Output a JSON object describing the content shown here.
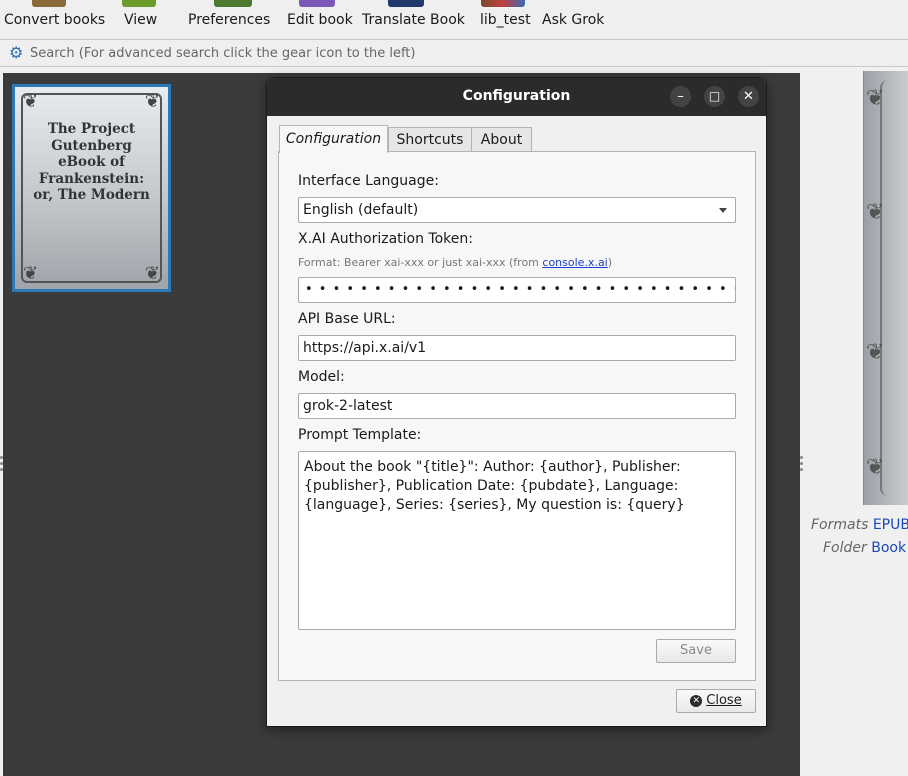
{
  "toolbar": {
    "items": [
      {
        "label": "Convert books",
        "icon": "convert-books-icon"
      },
      {
        "label": "View",
        "icon": "view-icon"
      },
      {
        "label": "Preferences",
        "icon": "preferences-icon"
      },
      {
        "label": "Edit book",
        "icon": "edit-book-icon"
      },
      {
        "label": "Translate Book",
        "icon": "translate-book-icon"
      },
      {
        "label": "lib_test",
        "icon": "lib-test-icon"
      },
      {
        "label": "Ask Grok",
        "icon": "ask-grok-icon"
      }
    ]
  },
  "search": {
    "placeholder": "Search (For advanced search click the gear icon to the left)",
    "icon": "gear-icon"
  },
  "library": {
    "book_cover_title": "The Project Gutenberg eBook of Frankenstein: or, The Modern"
  },
  "details": {
    "formats_label": "Formats",
    "formats_value": "EPUB",
    "folder_label": "Folder",
    "folder_value": "Book"
  },
  "dialog": {
    "title": "Configuration",
    "tabs": [
      "Configuration",
      "Shortcuts",
      "About"
    ],
    "active_tab": "Configuration",
    "interface_language_label": "Interface Language:",
    "interface_language_value": "English (default)",
    "token_label": "X.AI Authorization Token:",
    "token_hint_prefix": "Format: Bearer xai-xxx or just xai-xxx (from ",
    "token_hint_link": "console.x.ai",
    "token_hint_suffix": ")",
    "token_value": "• • • • • • • • • • • • • • • • • • • • • • • • • • • • • • • • • • • • • • •",
    "api_base_label": "API Base URL:",
    "api_base_value": "https://api.x.ai/v1",
    "model_label": "Model:",
    "model_value": "grok-2-latest",
    "prompt_label": "Prompt Template:",
    "prompt_value": "About the book \"{title}\": Author: {author}, Publisher: {publisher}, Publication Date: {pubdate}, Language: {language}, Series: {series}, My question is: {query}",
    "save_label": "Save",
    "close_label": "Close"
  },
  "colors": {
    "accent": "#2a7ab8",
    "titlebar": "#2b2b2b",
    "library_bg": "#3b3b3b",
    "link": "#1a3fcc"
  }
}
